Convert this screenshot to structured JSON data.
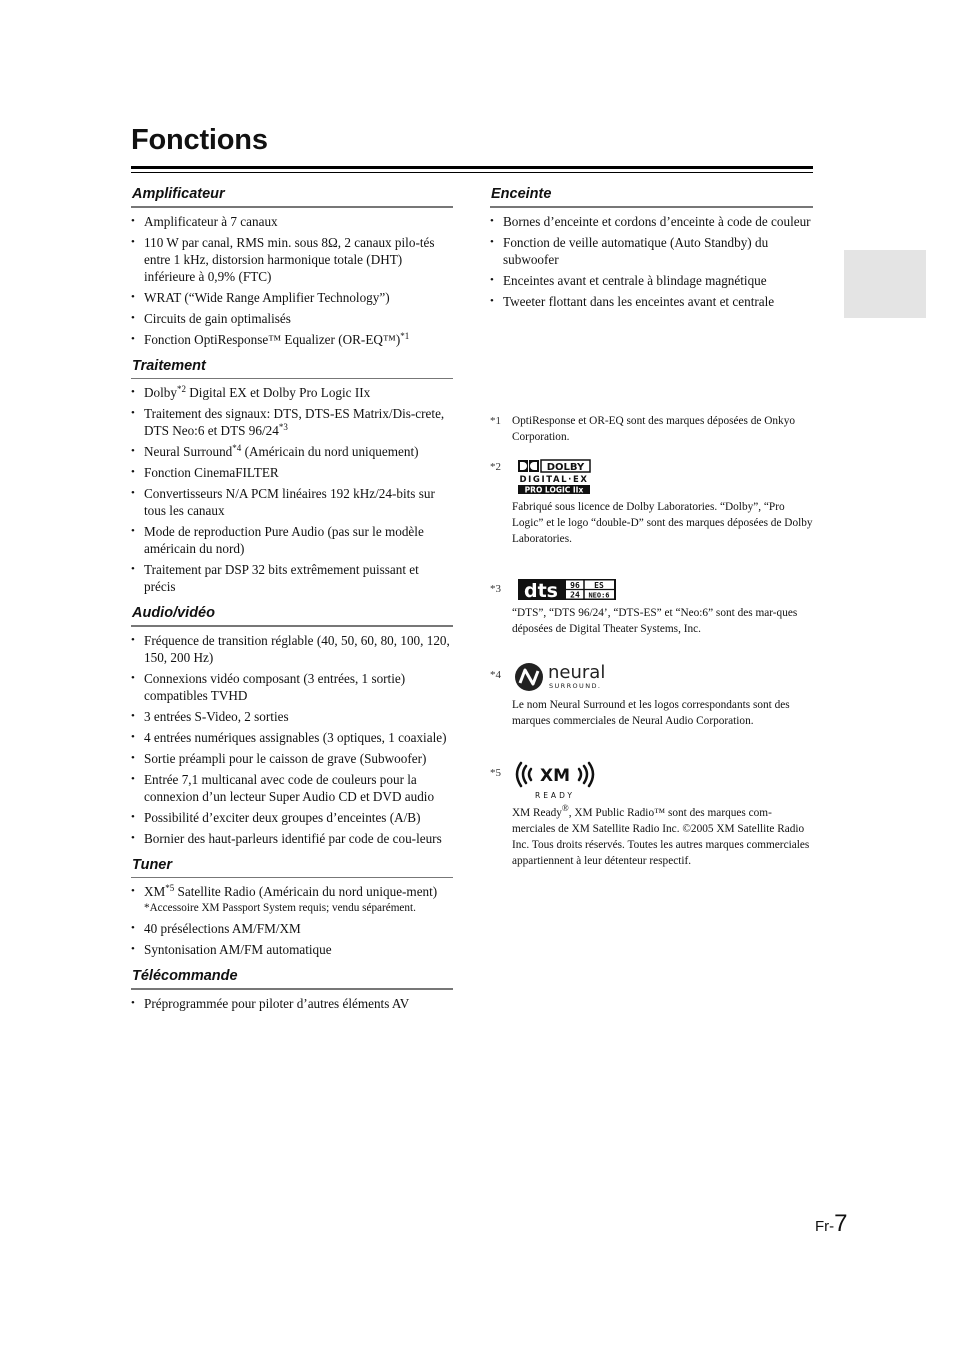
{
  "page": {
    "title": "Fonctions",
    "page_number_prefix": "Fr-",
    "page_number": "7"
  },
  "left_column": {
    "sections": [
      {
        "heading": "Amplificateur",
        "items": [
          {
            "text": "Amplificateur à 7 canaux"
          },
          {
            "text": "110 W par canal, RMS min. sous 8Ω, 2 canaux pilo-tés entre 1 kHz, distorsion harmonique totale (DHT) inférieure à 0,9% (FTC)"
          },
          {
            "text": "WRAT (“Wide Range Amplifier Technology”)"
          },
          {
            "text": "Circuits de gain optimalisés"
          },
          {
            "text": "Fonction OptiResponse™ Equalizer (OR-EQ™)",
            "sup": "*1"
          }
        ]
      },
      {
        "heading": "Traitement",
        "items": [
          {
            "pre": "Dolby",
            "sup": "*2",
            "post": " Digital EX et Dolby Pro Logic IIx"
          },
          {
            "pre": "Traitement des signaux: DTS, DTS-ES Matrix/Dis-crete, DTS Neo:6 et DTS 96/24",
            "sup": "*3",
            "post": ""
          },
          {
            "pre": "Neural Surround",
            "sup": "*4",
            "post": " (Américain du nord uniquement)"
          },
          {
            "text": "Fonction CinemaFILTER"
          },
          {
            "text": "Convertisseurs N/A PCM linéaires 192 kHz/24-bits sur tous les canaux"
          },
          {
            "text": "Mode de reproduction Pure Audio (pas sur le modèle américain du nord)"
          },
          {
            "text": "Traitement par DSP 32 bits extrêmement puissant et précis"
          }
        ]
      },
      {
        "heading": "Audio/vidéo",
        "items": [
          {
            "text": "Fréquence de transition réglable (40, 50, 60, 80, 100, 120, 150, 200 Hz)"
          },
          {
            "text": "Connexions vidéo composant (3 entrées, 1 sortie) compatibles TVHD"
          },
          {
            "text": "3 entrées S-Video, 2 sorties"
          },
          {
            "text": "4 entrées numériques assignables (3 optiques, 1 coaxiale)"
          },
          {
            "text": "Sortie préampli pour le caisson de grave (Subwoofer)"
          },
          {
            "text": "Entrée 7,1 multicanal avec code de couleurs pour la connexion d’un lecteur Super Audio CD et DVD audio"
          },
          {
            "text": "Possibilité d’exciter deux groupes d’enceintes (A/B)"
          },
          {
            "text": "Bornier des haut-parleurs identifié par code de cou-leurs"
          }
        ]
      },
      {
        "heading": "Tuner",
        "items": [
          {
            "pre": "XM",
            "sup": "*5",
            "post": " Satellite Radio (Américain du nord unique-ment)",
            "note": "*Accessoire XM Passport System requis; vendu séparément."
          },
          {
            "text": "40 présélections AM/FM/XM"
          },
          {
            "text": "Syntonisation AM/FM automatique"
          }
        ]
      },
      {
        "heading": "Télécommande",
        "items": [
          {
            "text": "Préprogrammée pour piloter d’autres éléments AV"
          }
        ]
      }
    ]
  },
  "right_column": {
    "sections": [
      {
        "heading": "Enceinte",
        "items": [
          {
            "text": "Bornes d’enceinte et cordons d’enceinte à code de couleur"
          },
          {
            "text": "Fonction de veille automatique (Auto Standby) du subwoofer"
          },
          {
            "text": "Enceintes avant et centrale à blindage magnétique"
          },
          {
            "text": "Tweeter flottant dans les enceintes avant et centrale"
          }
        ]
      }
    ]
  },
  "footnotes": [
    {
      "mark": "*1",
      "logo": null,
      "text": "OptiResponse et OR-EQ sont des marques déposées de Onkyo Corporation."
    },
    {
      "mark": "*2",
      "logo": {
        "icon": "dolby-digital-ex-pro-logic-iix-logo",
        "line1": "DOLBY",
        "line2": "DIGITAL·EX",
        "line3": "PRO LOGIC IIx"
      },
      "text": "Fabriqué sous licence de Dolby Laboratories. “Dolby”, “Pro Logic” et le logo “double-D” sont des marques déposées de Dolby Laboratories."
    },
    {
      "mark": "*3",
      "logo": {
        "icon": "dts-96-24-es-neo6-logo",
        "main": "dts",
        "a": "96",
        "b": "24",
        "c": "ES",
        "d": "NEO:6"
      },
      "text": "“DTS”, “DTS 96/24’, “DTS-ES” et “Neo:6” sont des mar-ques déposées de Digital Theater Systems, Inc."
    },
    {
      "mark": "*4",
      "logo": {
        "icon": "neural-surround-logo",
        "word": "neural",
        "sub": "SURROUND."
      },
      "text": "Le nom Neural Surround et les logos correspondants sont des marques commerciales de Neural Audio Corporation."
    },
    {
      "mark": "*5",
      "logo": {
        "icon": "xm-ready-logo",
        "word": "XM",
        "sub": "READY"
      },
      "text": "XM Ready®, XM Public Radio™ sont des marques com-merciales de XM Satellite Radio Inc. ©2005 XM Satellite Radio Inc. Tous droits réservés. Toutes les autres marques commerciales appartiennent à leur détenteur respectif."
    }
  ]
}
